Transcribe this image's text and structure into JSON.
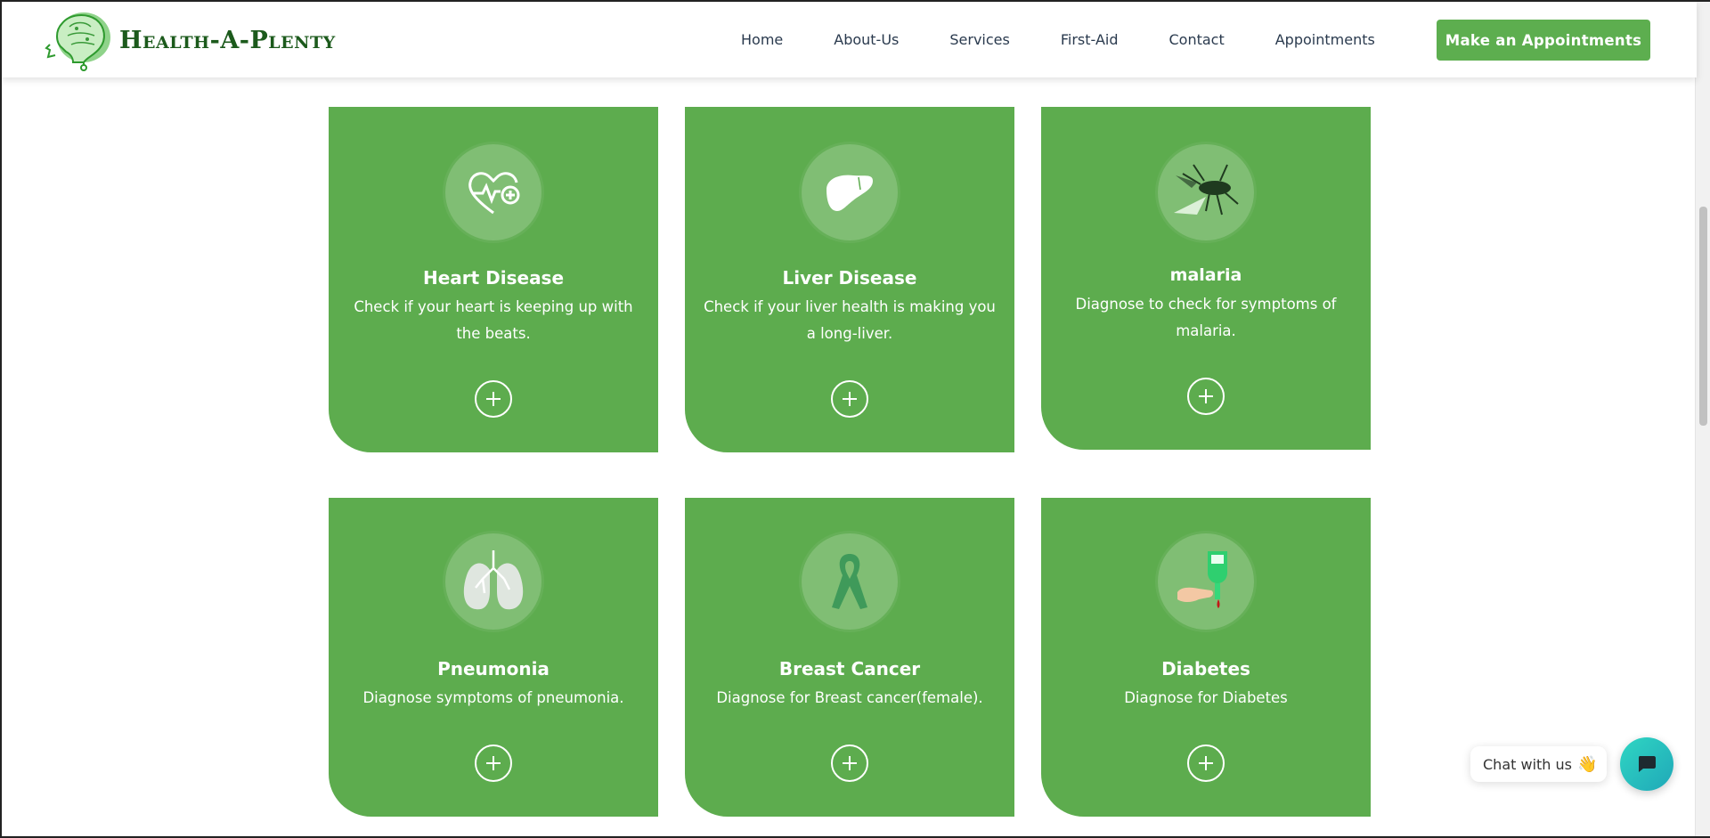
{
  "brand": {
    "name": "Health-A-Plenty"
  },
  "nav": {
    "items": [
      "Home",
      "About-Us",
      "Services",
      "First-Aid",
      "Contact",
      "Appointments"
    ],
    "cta": "Make an Appointments"
  },
  "cards": [
    {
      "title": "Heart Disease",
      "desc": "Check if your heart is keeping up with the beats.",
      "icon": "heart-pulse-icon"
    },
    {
      "title": "Liver Disease",
      "desc": "Check if your liver health is making you a long-liver.",
      "icon": "liver-icon"
    },
    {
      "title": "malaria",
      "desc": "Diagnose to check for symptoms of malaria.",
      "icon": "mosquito-icon"
    },
    {
      "title": "Pneumonia",
      "desc": "Diagnose symptoms of pneumonia.",
      "icon": "lungs-icon"
    },
    {
      "title": "Breast Cancer",
      "desc": "Diagnose for Breast cancer(female).",
      "icon": "ribbon-icon"
    },
    {
      "title": "Diabetes",
      "desc": "Diagnose for Diabetes",
      "icon": "glucometer-icon"
    }
  ],
  "chat": {
    "label": "Chat with us",
    "emoji": "👋"
  },
  "colors": {
    "card": "#5dac4e",
    "brand": "#1c5a1c",
    "cta": "#5dae4f",
    "chat_fab": "#2fd6c3"
  }
}
